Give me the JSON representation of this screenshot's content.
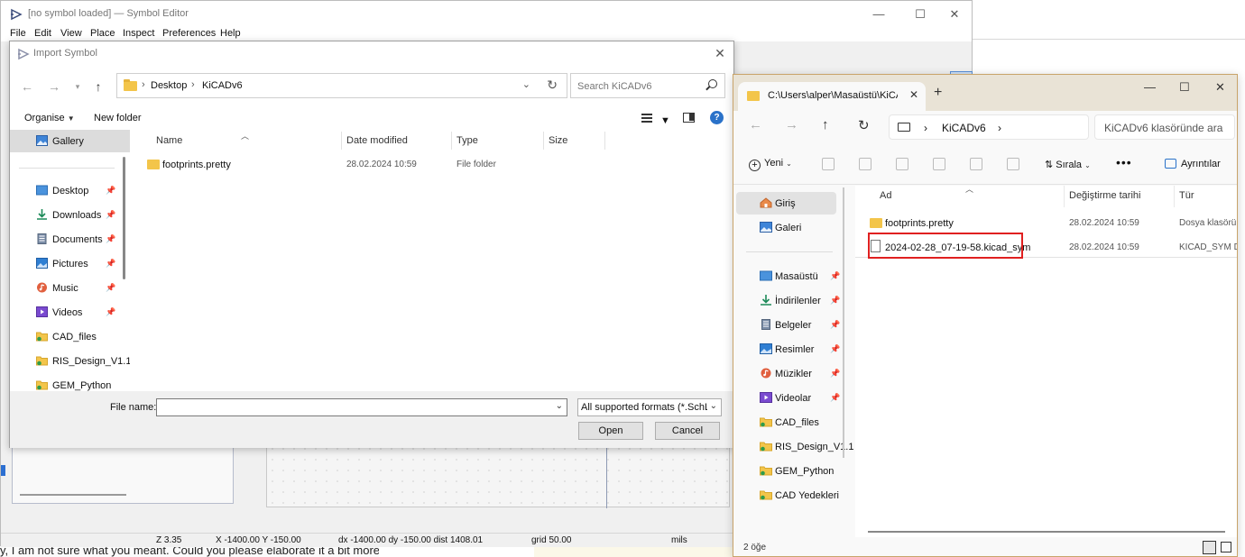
{
  "background": {
    "web_text": "y, I am not sure what you meant. Could you please elaborate it a bit more?"
  },
  "kicad": {
    "title": "[no symbol loaded] — Symbol Editor",
    "window_buttons": {
      "minimize": "—",
      "maximize": "☐",
      "close": "✕"
    },
    "menu": [
      "File",
      "Edit",
      "View",
      "Place",
      "Inspect",
      "Preferences",
      "Help"
    ],
    "status": {
      "zoom": "Z 3.35",
      "coords": "X -1400.00  Y -150.00",
      "delta": "dx -1400.00  dy -150.00  dist 1408.01",
      "grid": "grid 50.00",
      "units": "mils"
    }
  },
  "dialog": {
    "title": "Import Symbol",
    "close": "✕",
    "breadcrumb": [
      "Desktop",
      "KiCADv6"
    ],
    "search_placeholder": "Search KiCADv6",
    "toolbar": {
      "organise": "Organise",
      "new_folder": "New folder",
      "help": "?"
    },
    "sidebar": {
      "gallery": "Gallery",
      "items": [
        {
          "label": "Desktop",
          "icon": "desktop-icon",
          "pinned": true
        },
        {
          "label": "Downloads",
          "icon": "downloads-icon",
          "pinned": true
        },
        {
          "label": "Documents",
          "icon": "documents-icon",
          "pinned": true
        },
        {
          "label": "Pictures",
          "icon": "pictures-icon",
          "pinned": true
        },
        {
          "label": "Music",
          "icon": "music-icon",
          "pinned": true
        },
        {
          "label": "Videos",
          "icon": "videos-icon",
          "pinned": true
        },
        {
          "label": "CAD_files",
          "icon": "folder-icon",
          "pinned": false
        },
        {
          "label": "RIS_Design_V1.1",
          "icon": "folder-icon",
          "pinned": false
        },
        {
          "label": "GEM_Python",
          "icon": "folder-icon",
          "pinned": false
        }
      ]
    },
    "columns": {
      "name": "Name",
      "date": "Date modified",
      "type": "Type",
      "size": "Size"
    },
    "files": [
      {
        "name": "footprints.pretty",
        "date": "28.02.2024 10:59",
        "type": "File folder"
      }
    ],
    "file_name_label": "File name:",
    "file_name_value": "",
    "filter": "All supported formats (*.SchLib",
    "open_button": "Open",
    "cancel_button": "Cancel"
  },
  "explorer": {
    "tab_title": "C:\\Users\\alper\\Masaüstü\\KiCA",
    "tab_close": "✕",
    "new_tab": "+",
    "window_buttons": {
      "minimize": "—",
      "maximize": "☐",
      "close": "✕"
    },
    "address": [
      "KiCADv6"
    ],
    "search_placeholder": "KiCADv6 klasöründe ara",
    "commands": {
      "new": "Yeni",
      "sort": "Sırala",
      "more": "•••",
      "details": "Ayrıntılar"
    },
    "sidebar": {
      "top": [
        {
          "label": "Giriş",
          "icon": "home-icon"
        },
        {
          "label": "Galeri",
          "icon": "gallery-icon"
        }
      ],
      "items": [
        {
          "label": "Masaüstü",
          "icon": "desktop-icon",
          "pinned": true
        },
        {
          "label": "İndirilenler",
          "icon": "downloads-icon",
          "pinned": true
        },
        {
          "label": "Belgeler",
          "icon": "documents-icon",
          "pinned": true
        },
        {
          "label": "Resimler",
          "icon": "pictures-icon",
          "pinned": true
        },
        {
          "label": "Müzikler",
          "icon": "music-icon",
          "pinned": true
        },
        {
          "label": "Videolar",
          "icon": "videos-icon",
          "pinned": true
        },
        {
          "label": "CAD_files",
          "icon": "folder-icon",
          "pinned": false
        },
        {
          "label": "RIS_Design_V1.1",
          "icon": "folder-icon",
          "pinned": false
        },
        {
          "label": "GEM_Python",
          "icon": "folder-icon",
          "pinned": false
        },
        {
          "label": "CAD Yedekleri",
          "icon": "folder-icon",
          "pinned": false
        }
      ]
    },
    "columns": {
      "name": "Ad",
      "date": "Değiştirme tarihi",
      "type": "Tür"
    },
    "files": [
      {
        "name": "footprints.pretty",
        "date": "28.02.2024 10:59",
        "type": "Dosya klasörü",
        "kind": "folder"
      },
      {
        "name": "2024-02-28_07-19-58.kicad_sym",
        "date": "28.02.2024 10:59",
        "type": "KICAD_SYM Dosyası",
        "kind": "file"
      }
    ],
    "status": "2 öğe",
    "colors": {
      "highlight": "#e02020",
      "folder": "#f3c54a"
    }
  }
}
